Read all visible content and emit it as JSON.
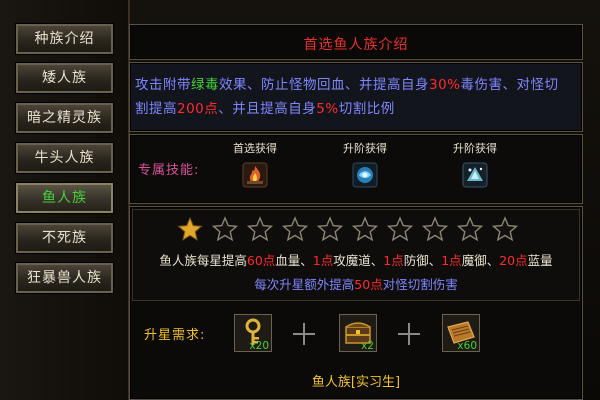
{
  "sidebar": {
    "items": [
      {
        "label": "种族介绍"
      },
      {
        "label": "矮人族"
      },
      {
        "label": "暗之精灵族"
      },
      {
        "label": "牛头人族"
      },
      {
        "label": "鱼人族"
      },
      {
        "label": "不死族"
      },
      {
        "label": "狂暴兽人族"
      }
    ],
    "active_index": 4
  },
  "header": {
    "title": "首选鱼人族介绍"
  },
  "description": {
    "l1a": "攻击附带",
    "l1b": "绿毒",
    "l1c": "效果、防止怪物回血、并提高自身",
    "l1d": "30%",
    "l1e": "毒伤害、对怪切",
    "l2a": "割提高",
    "l2b": "200点",
    "l2c": "、并且提高自身",
    "l2d": "5%",
    "l2e": "切割比例"
  },
  "skills": {
    "label": "专属技能:",
    "items": [
      {
        "caption": "首选获得",
        "icon": "fire-skill-icon"
      },
      {
        "caption": "升阶获得",
        "icon": "water-skill-icon"
      },
      {
        "caption": "升阶获得",
        "icon": "frost-skill-icon"
      }
    ]
  },
  "stars": {
    "total": 10,
    "filled": 1
  },
  "bonus": {
    "a": "鱼人族每星提高",
    "b": "60点",
    "c": "血量、",
    "d": "1点",
    "e": "攻魔道、",
    "f": "1点",
    "g": "防御、",
    "h": "1点",
    "i": "魔御、",
    "j": "20点",
    "k": "蓝量",
    "extra_a": "每次升星额外提高",
    "extra_b": "50点",
    "extra_c": "对怪切割伤害"
  },
  "upgrade": {
    "label": "升星需求:",
    "items": [
      {
        "icon": "golden-key-icon",
        "count": "x20"
      },
      {
        "icon": "treasure-chest-icon",
        "count": "x2"
      },
      {
        "icon": "scroll-book-icon",
        "count": "x60"
      }
    ],
    "rank_name": "鱼人族[实习生]"
  },
  "colors": {
    "accent_green": "#46d23a",
    "accent_red": "#ff2a2a",
    "text_blue": "#7f86ff",
    "gold": "#f2c22a",
    "pink": "#d9529a"
  }
}
